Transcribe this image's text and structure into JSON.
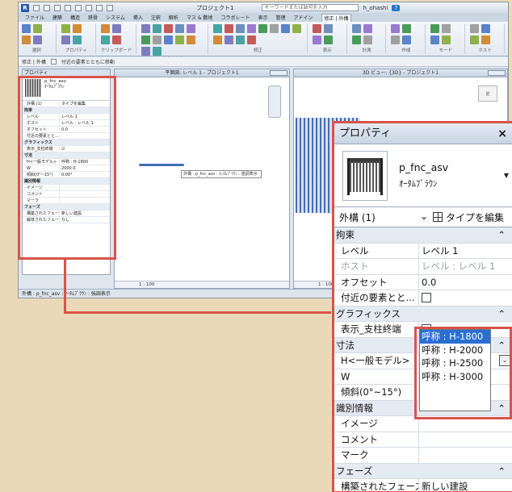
{
  "app": {
    "title": "プロジェクト1",
    "search_placeholder": "キーワードまたは語句を入力",
    "user": "h_ohashi",
    "tabs": [
      "ファイル",
      "建築",
      "構造",
      "鉄骨",
      "システム",
      "挿入",
      "注釈",
      "解析",
      "マス & 敷地",
      "コラボレート",
      "表示",
      "管理",
      "アドイン",
      "修正 | 外構"
    ],
    "active_tab": "修正 | 外構",
    "ribbon_groups": [
      "選択",
      "プロパティ",
      "クリップボード",
      "ジオメトリ",
      "修正",
      "表示",
      "計測",
      "作成",
      "モード",
      "ホスト"
    ],
    "options_bar": [
      "修正 | 外構",
      "付近の要素とともに移動"
    ],
    "status_text": "外構 : p_fnc_asv : ｵｰﾀﾑﾌﾞﾗｳﾝ : 強調表示",
    "scale": "1 : 100"
  },
  "views": {
    "plan_title": "平面図: レベル 1 - プロジェクト1",
    "view3d_title": "3D ビュー: {3D} - プロジェクト1",
    "tooltip": "外構 : p_fnc_asv : ｵｰﾀﾑﾌﾞﾗｳﾝ : 強調表示",
    "viewcube_label": "前"
  },
  "properties": {
    "panel_title": "プロパティ",
    "family": "p_fnc_asv",
    "type": "ｵｰﾀﾑﾌﾞﾗｳﾝ",
    "filter": "外構 (1)",
    "edit_type": "タイプを編集",
    "rows": [
      {
        "cat": "拘束"
      },
      {
        "k": "レベル",
        "v": "レベル 1"
      },
      {
        "k": "ホスト",
        "v": "レベル : レベル 1",
        "gray": true
      },
      {
        "k": "オフセット",
        "v": "0.0"
      },
      {
        "k": "付近の要素とと...",
        "chk": false
      },
      {
        "cat": "グラフィックス"
      },
      {
        "k": "表示_支柱終端",
        "chk": true
      },
      {
        "cat": "寸法"
      },
      {
        "k": "H<一般モデル>",
        "v": "呼称 : H-1800",
        "selected": true
      },
      {
        "k": "W",
        "v": ""
      },
      {
        "k": "傾斜(0°~15°)",
        "v": ""
      },
      {
        "cat": "識別情報"
      },
      {
        "k": "イメージ",
        "v": ""
      },
      {
        "k": "コメント",
        "v": ""
      },
      {
        "k": "マーク",
        "v": ""
      },
      {
        "cat": "フェーズ"
      },
      {
        "k": "構築されたフェーズ",
        "v": "新しい建設"
      },
      {
        "k": "解体されたフェーズ",
        "v": "なし"
      }
    ],
    "mini_rows": [
      {
        "cat": "拘束"
      },
      {
        "k": "レベル",
        "v": "レベル 1"
      },
      {
        "k": "ホスト",
        "v": "レベル : レベル 1"
      },
      {
        "k": "オフセット",
        "v": "0.0"
      },
      {
        "k": "付近の要素とと...",
        "v": ""
      },
      {
        "cat": "グラフィックス"
      },
      {
        "k": "表示_支柱終端",
        "v": "☑"
      },
      {
        "cat": "寸法"
      },
      {
        "k": "H<一般モデル>",
        "v": "呼称 : H-1800"
      },
      {
        "k": "W",
        "v": "2000.0"
      },
      {
        "k": "傾斜(0°~15°)",
        "v": "0.00°"
      },
      {
        "cat": "識別情報"
      },
      {
        "k": "イメージ",
        "v": ""
      },
      {
        "k": "コメント",
        "v": ""
      },
      {
        "k": "マーク",
        "v": ""
      },
      {
        "cat": "フェーズ"
      },
      {
        "k": "構築されたフェーズ",
        "v": "新しい建設"
      },
      {
        "k": "解体されたフェーズ",
        "v": "なし"
      }
    ]
  },
  "dropdown": {
    "options": [
      "呼称 : H-1800",
      "呼称 : H-2000",
      "呼称 : H-2500",
      "呼称 : H-3000"
    ],
    "highlighted": "呼称 : H-1800"
  },
  "colors": {
    "accent_red": "#d9534a",
    "selection_blue": "#2a6fd0",
    "background": "#ead9b8"
  }
}
